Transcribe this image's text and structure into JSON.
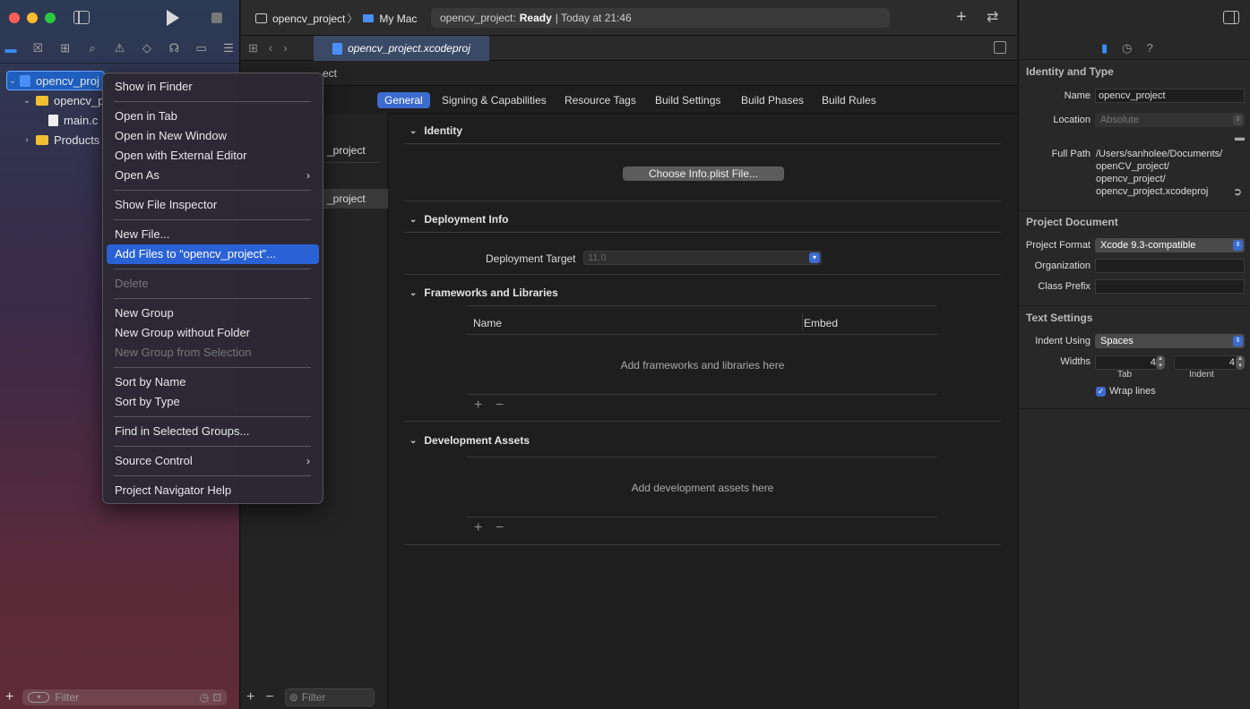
{
  "colors": {
    "accent": "#2a62d6",
    "folder": "#f0c030",
    "project_icon": "#4c8ef7"
  },
  "toolbar": {
    "scheme": "opencv_project",
    "destination": "My Mac",
    "status_project": "opencv_project:",
    "status_state": "Ready",
    "status_time": "| Today at 21:46"
  },
  "navigator": {
    "items": [
      {
        "label": "opencv_project",
        "type": "project",
        "expanded": true
      },
      {
        "label": "opencv_p",
        "type": "folder",
        "expanded": true
      },
      {
        "label": "main.c",
        "type": "file"
      },
      {
        "label": "Products",
        "type": "folder",
        "expanded": false
      }
    ],
    "filter_placeholder": "Filter"
  },
  "editor_tab": {
    "label": "opencv_project.xcodeproj"
  },
  "jumpbar": {
    "text": "ect"
  },
  "target_list": {
    "project_item": "_project",
    "target_item": "_project",
    "filter_placeholder": "Filter"
  },
  "settings_tabs": [
    "General",
    "Signing & Capabilities",
    "Resource Tags",
    "Build Settings",
    "Build Phases",
    "Build Rules"
  ],
  "editor": {
    "identity": {
      "title": "Identity",
      "button": "Choose Info.plist File..."
    },
    "deployment": {
      "title": "Deployment Info",
      "target_label": "Deployment Target",
      "target_value": "11.0"
    },
    "frameworks": {
      "title": "Frameworks and Libraries",
      "col_name": "Name",
      "col_embed": "Embed",
      "empty": "Add frameworks and libraries here"
    },
    "assets": {
      "title": "Development Assets",
      "empty": "Add development assets here"
    }
  },
  "inspector": {
    "identity_title": "Identity and Type",
    "name_label": "Name",
    "name_value": "opencv_project",
    "location_label": "Location",
    "location_value": "Absolute",
    "fullpath_label": "Full Path",
    "fullpath_lines": [
      "/Users/sanholee/Documents/",
      "openCV_project/",
      "opencv_project/",
      "opencv_project.xcodeproj"
    ],
    "doc_title": "Project Document",
    "format_label": "Project Format",
    "format_value": "Xcode 9.3-compatible",
    "org_label": "Organization",
    "prefix_label": "Class Prefix",
    "text_title": "Text Settings",
    "indent_label": "Indent Using",
    "indent_value": "Spaces",
    "widths_label": "Widths",
    "tab_value": "4",
    "indent_width_value": "4",
    "tab_caption": "Tab",
    "indent_caption": "Indent",
    "wrap_label": "Wrap lines"
  },
  "context_menu": {
    "show_in_finder": "Show in Finder",
    "open_in_tab": "Open in Tab",
    "open_new_window": "Open in New Window",
    "open_external": "Open with External Editor",
    "open_as": "Open As",
    "show_inspector": "Show File Inspector",
    "new_file": "New File...",
    "add_files": "Add Files to “opencv_project”...",
    "delete": "Delete",
    "new_group": "New Group",
    "new_group_nofolder": "New Group without Folder",
    "new_group_selection": "New Group from Selection",
    "sort_name": "Sort by Name",
    "sort_type": "Sort by Type",
    "find_in_groups": "Find in Selected Groups...",
    "source_control": "Source Control",
    "nav_help": "Project Navigator Help"
  }
}
